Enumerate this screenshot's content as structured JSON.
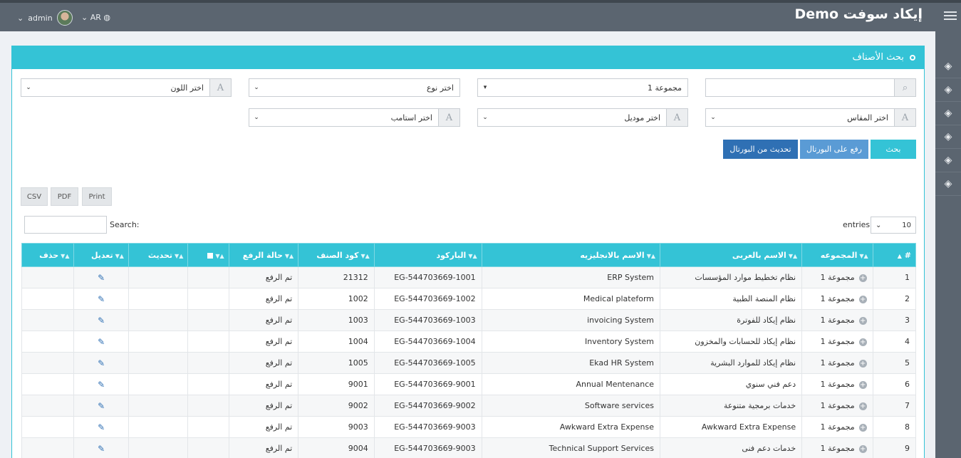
{
  "topbar": {
    "brand": "إيكاد سوفت Demo",
    "lang": "AR",
    "user": "admin"
  },
  "panel": {
    "title": "بحث الأصناف"
  },
  "filters": {
    "search_placeholder": "",
    "group": "مجموعة 1",
    "type": "اختر نوع",
    "color": "اختر اللون",
    "size": "اختر المقاس",
    "model": "اختر موديل",
    "stamp": "اختر استامب"
  },
  "buttons": {
    "search": "بحث",
    "upload_portal": "رفع على البورتال",
    "update_portal": "تحديث من البورتال"
  },
  "export": {
    "print": "Print",
    "pdf": "PDF",
    "csv": "CSV"
  },
  "table_controls": {
    "search_label": "Search:",
    "entries_label": "entries",
    "entries_value": "10"
  },
  "table": {
    "columns": [
      "#",
      "المجموعه",
      "الاسم بالعربى",
      "الاسم بالانجليزيه",
      "الباركود",
      "كود الصنف",
      "حالة الرفع",
      "",
      "تحديث",
      "تعديل",
      "حذف"
    ],
    "rows": [
      {
        "n": "1",
        "group": "مجموعة 1",
        "ar": "نظام تخطيط موارد المؤسسات",
        "en": "ERP System",
        "barcode": "EG-544703669-1001",
        "code": "21312",
        "status": "تم الرفع"
      },
      {
        "n": "2",
        "group": "مجموعة 1",
        "ar": "نظام المنصة الطبية",
        "en": "Medical plateform",
        "barcode": "EG-544703669-1002",
        "code": "1002",
        "status": "تم الرفع"
      },
      {
        "n": "3",
        "group": "مجموعة 1",
        "ar": "نظام إيكاد للفوترة",
        "en": "invoicing System",
        "barcode": "EG-544703669-1003",
        "code": "1003",
        "status": "تم الرفع"
      },
      {
        "n": "4",
        "group": "مجموعة 1",
        "ar": "نظام إيكاد للحسابات والمخزون",
        "en": "Inventory System",
        "barcode": "EG-544703669-1004",
        "code": "1004",
        "status": "تم الرفع"
      },
      {
        "n": "5",
        "group": "مجموعة 1",
        "ar": "نظام إيكاد للموارد البشرية",
        "en": "Ekad HR System",
        "barcode": "EG-544703669-1005",
        "code": "1005",
        "status": "تم الرفع"
      },
      {
        "n": "6",
        "group": "مجموعة 1",
        "ar": "دعم فني سنوي",
        "en": "Annual Mentenance",
        "barcode": "EG-544703669-9001",
        "code": "9001",
        "status": "تم الرفع"
      },
      {
        "n": "7",
        "group": "مجموعة 1",
        "ar": "خدمات برمجية متنوعة",
        "en": "Software services",
        "barcode": "EG-544703669-9002",
        "code": "9002",
        "status": "تم الرفع"
      },
      {
        "n": "8",
        "group": "مجموعة 1",
        "ar": "Awkward Extra Expense",
        "en": "Awkward Extra Expense",
        "barcode": "EG-544703669-9003",
        "code": "9003",
        "status": "تم الرفع"
      },
      {
        "n": "9",
        "group": "مجموعة 1",
        "ar": "خدمات دعم فنى",
        "en": "Technical Support Services",
        "barcode": "EG-544703669-9003",
        "code": "9004",
        "status": "تم الرفع"
      }
    ]
  }
}
